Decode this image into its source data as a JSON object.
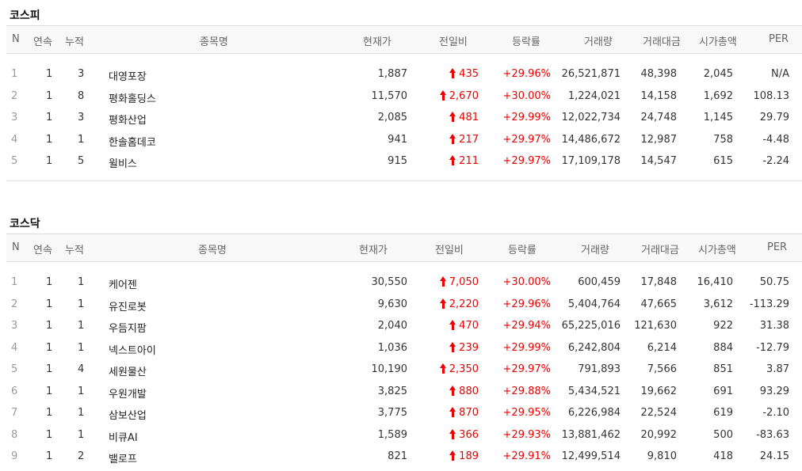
{
  "columns": {
    "n": "N",
    "streak": "연속",
    "cumulative": "누적",
    "name": "종목명",
    "price": "현재가",
    "change": "전일비",
    "rate": "등락률",
    "volume": "거래량",
    "trade_value": "거래대금",
    "market_cap": "시가총액",
    "per": "PER"
  },
  "kospi": {
    "title": "코스피",
    "rows": [
      {
        "n": "1",
        "streak": "1",
        "cum": "3",
        "name": "대영포장",
        "price": "1,887",
        "change": "435",
        "rate": "+29.96%",
        "volume": "26,521,871",
        "value": "48,398",
        "cap": "2,045",
        "per": "N/A"
      },
      {
        "n": "2",
        "streak": "1",
        "cum": "8",
        "name": "평화홀딩스",
        "price": "11,570",
        "change": "2,670",
        "rate": "+30.00%",
        "volume": "1,224,021",
        "value": "14,158",
        "cap": "1,692",
        "per": "108.13"
      },
      {
        "n": "3",
        "streak": "1",
        "cum": "3",
        "name": "평화산업",
        "price": "2,085",
        "change": "481",
        "rate": "+29.99%",
        "volume": "12,022,734",
        "value": "24,748",
        "cap": "1,145",
        "per": "29.79"
      },
      {
        "n": "4",
        "streak": "1",
        "cum": "1",
        "name": "한솔홈데코",
        "price": "941",
        "change": "217",
        "rate": "+29.97%",
        "volume": "14,486,672",
        "value": "12,987",
        "cap": "758",
        "per": "-4.48"
      },
      {
        "n": "5",
        "streak": "1",
        "cum": "5",
        "name": "윌비스",
        "price": "915",
        "change": "211",
        "rate": "+29.97%",
        "volume": "17,109,178",
        "value": "14,547",
        "cap": "615",
        "per": "-2.24"
      }
    ]
  },
  "kosdaq": {
    "title": "코스닥",
    "rows": [
      {
        "n": "1",
        "streak": "1",
        "cum": "1",
        "name": "케어젠",
        "price": "30,550",
        "change": "7,050",
        "rate": "+30.00%",
        "volume": "600,459",
        "value": "17,848",
        "cap": "16,410",
        "per": "50.75"
      },
      {
        "n": "2",
        "streak": "1",
        "cum": "1",
        "name": "유진로봇",
        "price": "9,630",
        "change": "2,220",
        "rate": "+29.96%",
        "volume": "5,404,764",
        "value": "47,665",
        "cap": "3,612",
        "per": "-113.29"
      },
      {
        "n": "3",
        "streak": "1",
        "cum": "1",
        "name": "우듬지팜",
        "price": "2,040",
        "change": "470",
        "rate": "+29.94%",
        "volume": "65,225,016",
        "value": "121,630",
        "cap": "922",
        "per": "31.38"
      },
      {
        "n": "4",
        "streak": "1",
        "cum": "1",
        "name": "넥스트아이",
        "price": "1,036",
        "change": "239",
        "rate": "+29.99%",
        "volume": "6,242,804",
        "value": "6,214",
        "cap": "884",
        "per": "-12.79"
      },
      {
        "n": "5",
        "streak": "1",
        "cum": "4",
        "name": "세원물산",
        "price": "10,190",
        "change": "2,350",
        "rate": "+29.97%",
        "volume": "791,893",
        "value": "7,566",
        "cap": "851",
        "per": "3.87"
      },
      {
        "n": "6",
        "streak": "1",
        "cum": "1",
        "name": "우원개발",
        "price": "3,825",
        "change": "880",
        "rate": "+29.88%",
        "volume": "5,434,521",
        "value": "19,662",
        "cap": "691",
        "per": "93.29"
      },
      {
        "n": "7",
        "streak": "1",
        "cum": "1",
        "name": "삼보산업",
        "price": "3,775",
        "change": "870",
        "rate": "+29.95%",
        "volume": "6,226,984",
        "value": "22,524",
        "cap": "619",
        "per": "-2.10"
      },
      {
        "n": "8",
        "streak": "1",
        "cum": "1",
        "name": "비큐AI",
        "price": "1,589",
        "change": "366",
        "rate": "+29.93%",
        "volume": "13,881,462",
        "value": "20,992",
        "cap": "500",
        "per": "-83.63"
      },
      {
        "n": "9",
        "streak": "1",
        "cum": "2",
        "name": "밸로프",
        "price": "821",
        "change": "189",
        "rate": "+29.91%",
        "volume": "12,499,514",
        "value": "9,810",
        "cap": "418",
        "per": "24.15"
      }
    ]
  },
  "icons": {
    "up": "up-arrow-icon"
  },
  "colors": {
    "up": "#e00000",
    "header_bg": "#f8f8f8",
    "border": "#dddddd"
  }
}
